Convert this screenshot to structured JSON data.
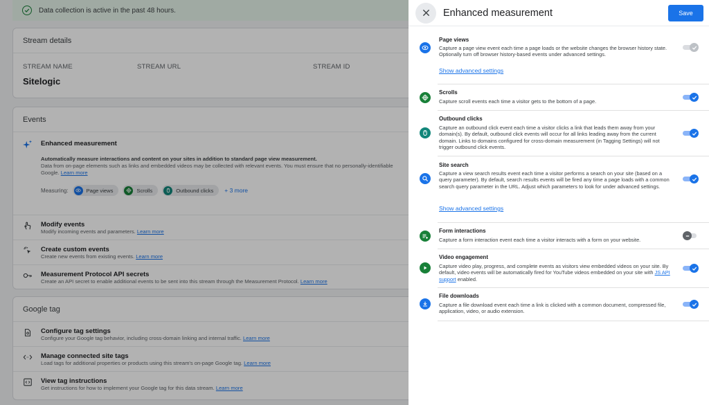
{
  "banner": {
    "text": "Data collection is active in the past 48 hours."
  },
  "stream_details": {
    "title": "Stream details",
    "labels": [
      "STREAM NAME",
      "STREAM URL",
      "STREAM ID"
    ],
    "stream_name": "Sitelogic"
  },
  "events": {
    "title": "Events",
    "enhanced": {
      "title": "Enhanced measurement",
      "desc_bold": "Automatically measure interactions and content on your sites in addition to standard page view measurement.",
      "desc": "Data from on-page elements such as links and embedded videos may be collected with relevant events. You must ensure that no personally-identifiable",
      "desc2": "Google.",
      "learn_more": "Learn more",
      "measuring_label": "Measuring:",
      "chips": [
        "Page views",
        "Scrolls",
        "Outbound clicks"
      ],
      "more": "+ 3 more"
    },
    "rows": [
      {
        "title": "Modify events",
        "desc": "Modify incoming events and parameters.",
        "link": "Learn more"
      },
      {
        "title": "Create custom events",
        "desc": "Create new events from existing events.",
        "link": "Learn more"
      },
      {
        "title": "Measurement Protocol API secrets",
        "desc": "Create an API secret to enable additional events to be sent into this stream through the Measurement Protocol.",
        "link": "Learn more"
      }
    ]
  },
  "google_tag": {
    "title": "Google tag",
    "rows": [
      {
        "title": "Configure tag settings",
        "desc": "Configure your Google tag behavior, including cross-domain linking and internal traffic.",
        "link": "Learn more"
      },
      {
        "title": "Manage connected site tags",
        "desc": "Load tags for additional properties or products using this stream's on-page Google tag.",
        "link": "Learn more"
      },
      {
        "title": "View tag instructions",
        "desc": "Get instructions for how to implement your Google tag for this data stream.",
        "link": "Learn more"
      }
    ]
  },
  "panel": {
    "title": "Enhanced measurement",
    "save": "Save",
    "advanced_link": "Show advanced settings",
    "settings": [
      {
        "title": "Page views",
        "desc": "Capture a page view event each time a page loads or the website changes the browser history state. Optionally turn off browser history-based events under advanced settings.",
        "enabled": true,
        "locked": true,
        "icon": "eye-icon",
        "icon_color": "#1a73e8"
      },
      {
        "title": "Scrolls",
        "desc": "Capture scroll events each time a visitor gets to the bottom of a page.",
        "enabled": true,
        "icon": "crosshair-icon",
        "icon_color": "#188038"
      },
      {
        "title": "Outbound clicks",
        "desc": "Capture an outbound click event each time a visitor clicks a link that leads them away from your domain(s). By default, outbound click events will occur for all links leading away from the current domain. Links to domains configured for cross-domain measurement (in Tagging Settings) will not trigger outbound click events.",
        "enabled": true,
        "icon": "mouse-icon",
        "icon_color": "#12867a"
      },
      {
        "title": "Site search",
        "desc": "Capture a view search results event each time a visitor performs a search on your site (based on a query parameter). By default, search results events will be fired any time a page loads with a common search query parameter in the URL. Adjust which parameters to look for under advanced settings.",
        "enabled": true,
        "icon": "search-icon",
        "icon_color": "#1a73e8"
      },
      {
        "title": "Form interactions",
        "desc": "Capture a form interaction event each time a visitor interacts with a form on your website.",
        "enabled": false,
        "icon": "form-icon",
        "icon_color": "#188038"
      },
      {
        "title": "Video engagement",
        "desc_parts": [
          "Capture video play, progress, and complete events as visitors view embedded videos on your site. By default, video events will be automatically fired for YouTube videos embedded on your site with ",
          "JS API support",
          " enabled."
        ],
        "enabled": true,
        "icon": "play-icon",
        "icon_color": "#188038"
      },
      {
        "title": "File downloads",
        "desc": "Capture a file download event each time a link is clicked with a common document, compressed file, application, video, or audio extension.",
        "enabled": true,
        "icon": "download-icon",
        "icon_color": "#1a73e8"
      }
    ]
  }
}
